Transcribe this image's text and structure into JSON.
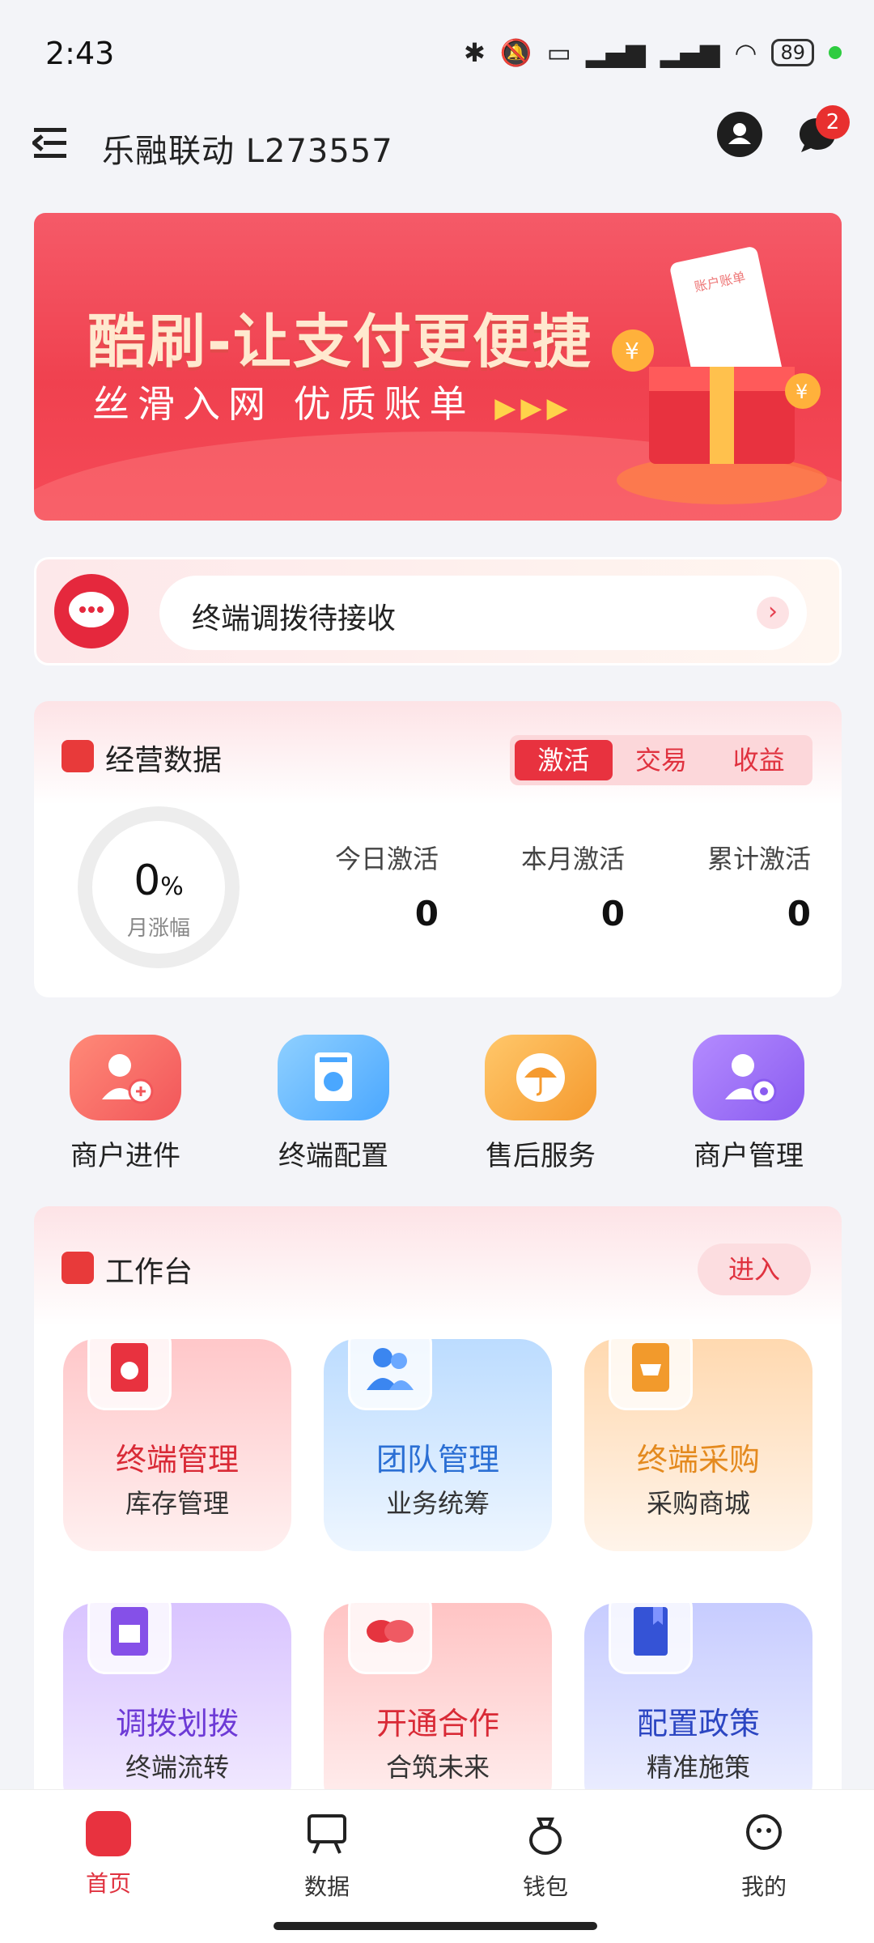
{
  "status_bar": {
    "time": "2:43",
    "battery": "89"
  },
  "header": {
    "title": "乐融联动   L273557",
    "message_badge": "2"
  },
  "banner": {
    "headline": "酷刷-让支付更便捷",
    "subline": "丝滑入网  优质账单",
    "paper_label": "账户账单"
  },
  "notice": {
    "text": "终端调拨待接收"
  },
  "business": {
    "title": "经营数据",
    "tabs": [
      "激活",
      "交易",
      "收益"
    ],
    "ring_value": "0",
    "ring_unit": "%",
    "ring_label": "月涨幅",
    "stats": [
      {
        "label": "今日激活",
        "value": "0"
      },
      {
        "label": "本月激活",
        "value": "0"
      },
      {
        "label": "累计激活",
        "value": "0"
      }
    ]
  },
  "quick_menu": [
    "商户进件",
    "终端配置",
    "售后服务",
    "商户管理"
  ],
  "workbench": {
    "title": "工作台",
    "enter_label": "进入",
    "tiles": [
      {
        "title": "终端管理",
        "sub": "库存管理"
      },
      {
        "title": "团队管理",
        "sub": "业务统筹"
      },
      {
        "title": "终端采购",
        "sub": "采购商城"
      },
      {
        "title": "调拨划拨",
        "sub": "终端流转"
      },
      {
        "title": "开通合作",
        "sub": "合筑未来"
      },
      {
        "title": "配置政策",
        "sub": "精准施策"
      }
    ]
  },
  "bottom_nav": [
    "首页",
    "数据",
    "钱包",
    "我的"
  ],
  "colors": {
    "accent": "#e0323f",
    "banner": "#f0414f"
  }
}
